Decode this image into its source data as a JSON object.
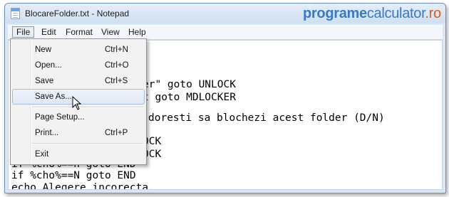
{
  "window": {
    "title": "BlocareFolder.txt - Notepad",
    "icon": "notepad-icon"
  },
  "watermark": {
    "part1": "programe",
    "part2": "calculator",
    "part3": ".ro"
  },
  "menubar": {
    "items": [
      "File",
      "Edit",
      "Format",
      "View",
      "Help"
    ],
    "active": "File"
  },
  "file_menu": {
    "items": [
      {
        "label": "New",
        "shortcut": "Ctrl+N"
      },
      {
        "label": "Open...",
        "shortcut": "Ctrl+O"
      },
      {
        "label": "Save",
        "shortcut": "Ctrl+S"
      },
      {
        "label": "Save As...",
        "shortcut": ""
      },
      {
        "label": "Page Setup...",
        "shortcut": ""
      },
      {
        "label": "Print...",
        "shortcut": "Ctrl+P"
      },
      {
        "label": "Exit",
        "shortcut": ""
      }
    ],
    "hovered": "Save As..."
  },
  "editor": {
    "lines": [
      "er\" goto UNLOCK",
      "t goto MDLOCKER",
      "doresti sa blochezi acest folder (D/N)",
      "OCK",
      "OCK",
      "if %cho%==n goto END",
      "if %cho%==N goto END",
      "echo Alegere incorecta."
    ]
  },
  "colors": {
    "accent": "#3a78c8",
    "watermark_accent": "#e05a1a",
    "menu_hover": "#dfe8f5"
  }
}
